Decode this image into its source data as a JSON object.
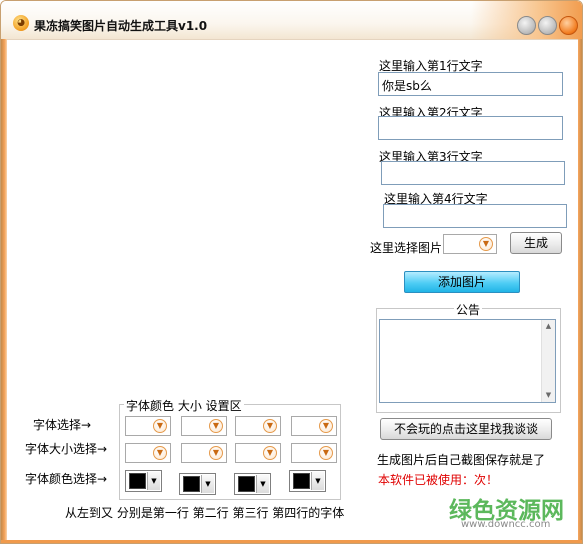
{
  "window": {
    "title": "果冻搞笑图片自动生成工具v1.0"
  },
  "lines": [
    {
      "label": "这里输入第1行文字",
      "value": "你是sb么"
    },
    {
      "label": "这里输入第2行文字",
      "value": ""
    },
    {
      "label": "这里输入第3行文字",
      "value": ""
    },
    {
      "label": "这里输入第4行文字",
      "value": ""
    }
  ],
  "image_select": {
    "label": "这里选择图片",
    "value": ""
  },
  "generate_button": "生成",
  "add_image_button": "添加图片",
  "notice": {
    "title": "公告",
    "content": ""
  },
  "help_button": "不会玩的点击这里找我谈谈",
  "info_text": "生成图片后自己截图保存就是了",
  "usage_text": "本软件已被使用：次！",
  "font_group": {
    "legend": "字体颜色 大小 设置区",
    "row_labels": {
      "font": "字体选择→",
      "size": "字体大小选择→",
      "color": "字体颜色选择→"
    },
    "footer": "从左到又 分别是第一行 第二行 第三行 第四行的字体"
  },
  "colors": {
    "accent_orange": "#f09a4c",
    "button_blue": "#4fcdf5",
    "warn_red": "#e00000",
    "swatch": "#000000"
  },
  "watermark": {
    "name": "绿色资源网",
    "url": "www.downcc.com"
  }
}
